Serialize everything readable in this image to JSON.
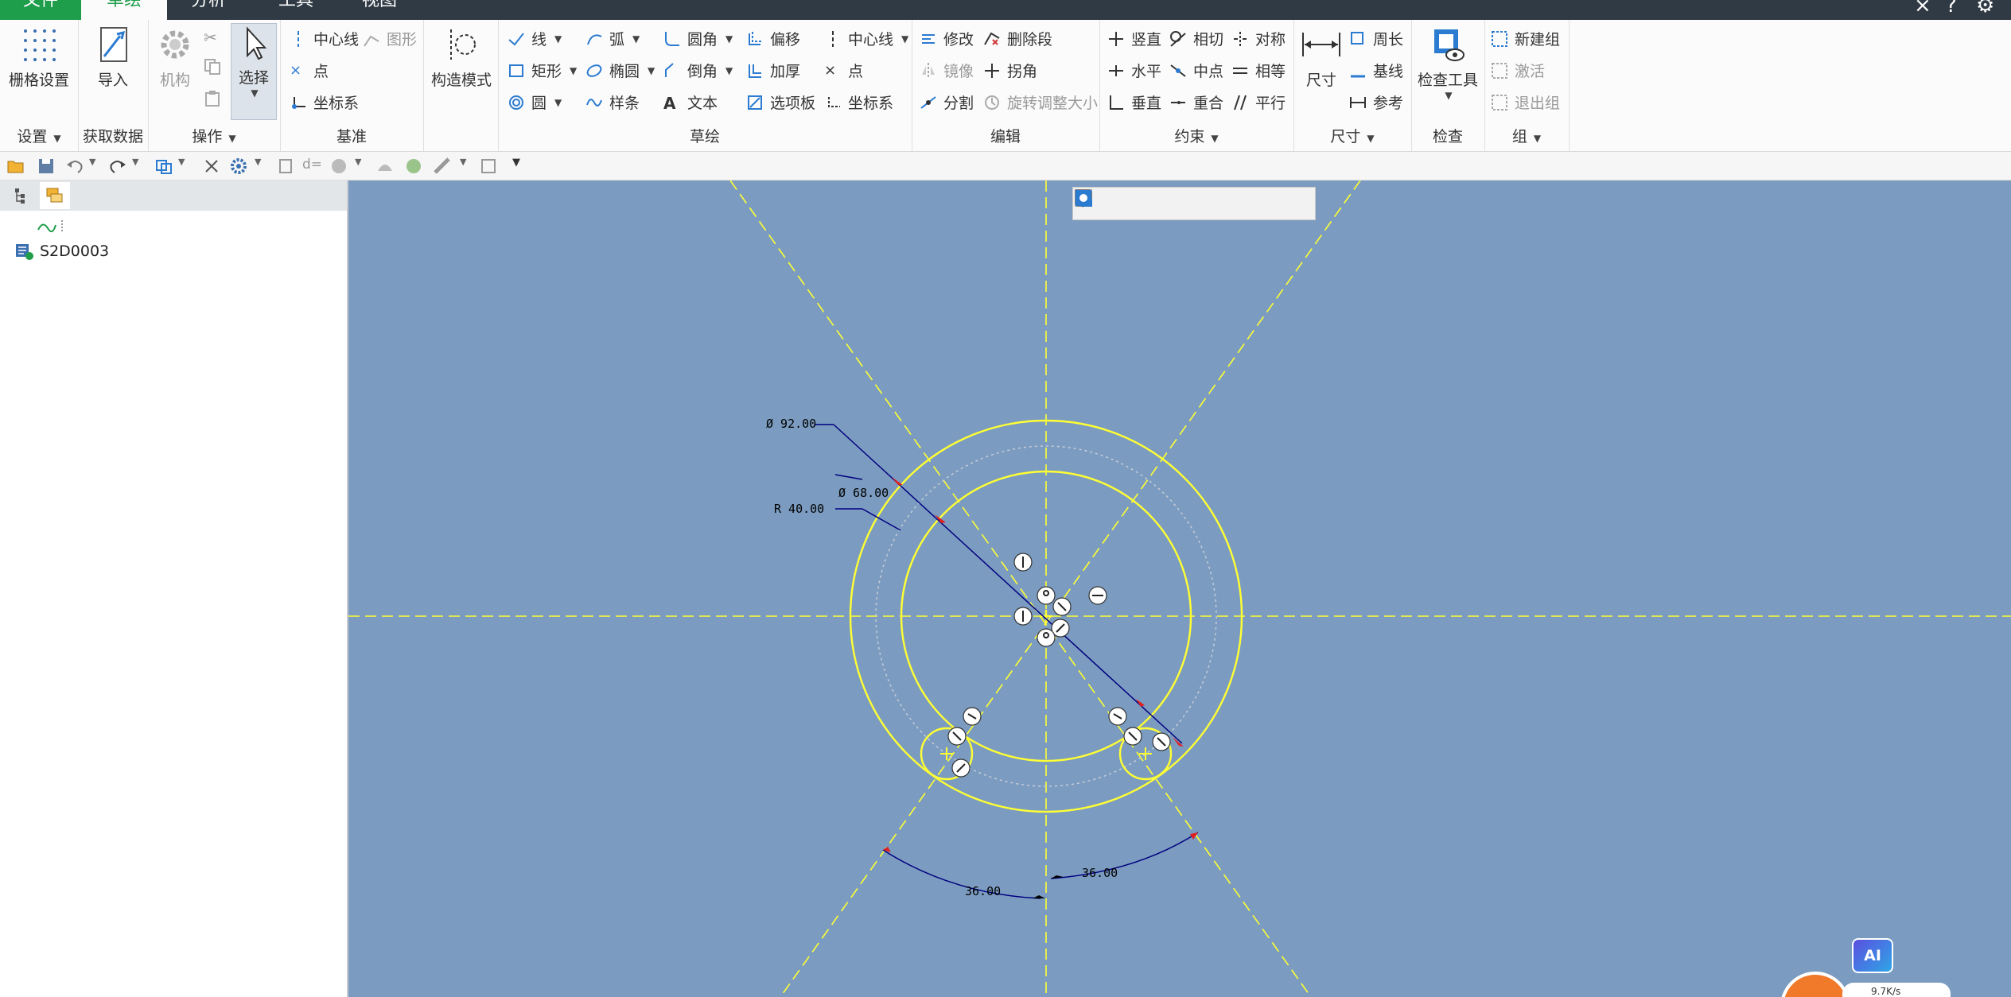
{
  "menu": {
    "tabs": [
      {
        "label": "文件"
      },
      {
        "label": "草绘"
      },
      {
        "label": "分析"
      },
      {
        "label": "工具"
      },
      {
        "label": "视图"
      }
    ]
  },
  "ribbon": {
    "groups": {
      "setup": {
        "label": "设置"
      },
      "get_data": {
        "label": "获取数据"
      },
      "operations": {
        "label": "操作"
      },
      "datum": {
        "label": "基准"
      },
      "sketch": {
        "label": "草绘"
      },
      "edit": {
        "label": "编辑"
      },
      "constrain": {
        "label": "约束"
      },
      "dimension": {
        "label": "尺寸"
      },
      "inspect": {
        "label": "检查"
      },
      "group": {
        "label": "组"
      }
    },
    "grid_settings": "栅格设置",
    "import": "导入",
    "mechanism": "机构",
    "select": "选择",
    "centerline": "中心线",
    "geometry": "图形",
    "point": "点",
    "csys": "坐标系",
    "construction_mode": "构造模式",
    "line": "线",
    "rectangle": "矩形",
    "circle": "圆",
    "arc": "弧",
    "ellipse": "椭圆",
    "spline": "样条",
    "fillet": "圆角",
    "chamfer": "倒角",
    "text": "文本",
    "offset": "偏移",
    "thicken": "加厚",
    "palette": "选项板",
    "centerline2": "中心线",
    "point2": "点",
    "csys2": "坐标系",
    "modify": "修改",
    "delete_segment": "删除段",
    "mirror": "镜像",
    "corner": "拐角",
    "divide": "分割",
    "rotate_resize": "旋转调整大小",
    "vertical": "竖直",
    "horizontal": "水平",
    "perpendicular": "垂直",
    "tangent": "相切",
    "midpoint": "中点",
    "coincident": "重合",
    "symmetric": "对称",
    "equal": "相等",
    "parallel": "平行",
    "dimension": "尺寸",
    "perimeter": "周长",
    "baseline": "基线",
    "reference": "参考",
    "inspect_tools": "检查工具",
    "new_group": "新建组",
    "activate": "激活",
    "exit_group": "退出组"
  },
  "model_tree": {
    "item": "S2D0003"
  },
  "sketch": {
    "dims": {
      "d92": "Ø 92.00",
      "d68": "Ø 68.00",
      "r40": "R 40.00",
      "a_left": "36.00",
      "a_right": "36.00"
    }
  },
  "badge": {
    "ai": "AI",
    "speed": "9.7K/s"
  },
  "colors": {
    "menubar": "#2f3a44",
    "active_tab": "#1e9e4a",
    "canvas": "#7b9cc0",
    "sketch_geometry": "#ffff33",
    "dimension_line": "#000080",
    "ai_badge": "#5a4fe0"
  }
}
